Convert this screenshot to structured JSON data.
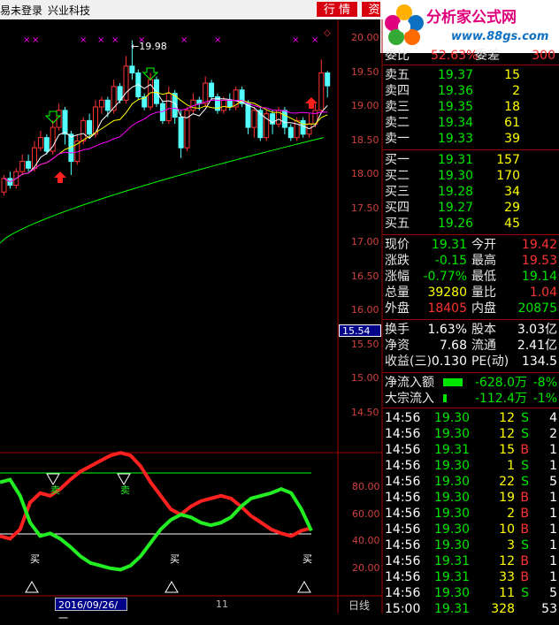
{
  "titlebar": {
    "login_status": "易未登录",
    "stock_name": "兴业科技",
    "btn_quote": "行 情",
    "btn_info": "资"
  },
  "logo": {
    "name": "分析家公式网",
    "url": "www.88gs.com"
  },
  "chart": {
    "price_axis": [
      "20.00",
      "19.50",
      "19.00",
      "18.50",
      "18.00",
      "17.50",
      "17.00",
      "16.50",
      "16.00",
      "15.50",
      "15.00",
      "14.50"
    ],
    "high_label": "19.98",
    "current_price_tag": "15.54",
    "sub_axis": [
      "80.00",
      "60.00",
      "40.00",
      "20.00"
    ],
    "sub_labels": {
      "sell": "卖",
      "buy": "买"
    },
    "date_tag": "2016/09/26/一",
    "month_tick": "11",
    "period": "日线",
    "colors": {
      "up": "#ff3232",
      "down": "#54ffff",
      "ma5": "#ffffff",
      "ma10": "#ffff00",
      "ma20": "#ff00ff",
      "ma60": "#00ff00"
    }
  },
  "quote": {
    "weibi": {
      "label": "委比",
      "value": "52.63%",
      "label2": "委差",
      "value2": "300"
    },
    "asks": [
      {
        "label": "卖五",
        "price": "19.37",
        "vol": "15"
      },
      {
        "label": "卖四",
        "price": "19.36",
        "vol": "2"
      },
      {
        "label": "卖三",
        "price": "19.35",
        "vol": "18"
      },
      {
        "label": "卖二",
        "price": "19.34",
        "vol": "61"
      },
      {
        "label": "卖一",
        "price": "19.33",
        "vol": "39"
      }
    ],
    "bids": [
      {
        "label": "买一",
        "price": "19.31",
        "vol": "157"
      },
      {
        "label": "买二",
        "price": "19.30",
        "vol": "170"
      },
      {
        "label": "买三",
        "price": "19.28",
        "vol": "34"
      },
      {
        "label": "买四",
        "price": "19.27",
        "vol": "29"
      },
      {
        "label": "买五",
        "price": "19.26",
        "vol": "45"
      }
    ],
    "stats": [
      {
        "l1": "现价",
        "v1": "19.31",
        "c1": "dn",
        "l2": "今开",
        "v2": "19.42",
        "c2": "up"
      },
      {
        "l1": "涨跌",
        "v1": "-0.15",
        "c1": "dn",
        "l2": "最高",
        "v2": "19.53",
        "c2": "up"
      },
      {
        "l1": "涨幅",
        "v1": "-0.77%",
        "c1": "dn",
        "l2": "最低",
        "v2": "19.14",
        "c2": "dn"
      },
      {
        "l1": "总量",
        "v1": "39280",
        "c1": "yel",
        "l2": "量比",
        "v2": "1.04",
        "c2": "up"
      },
      {
        "l1": "外盘",
        "v1": "18405",
        "c1": "up",
        "l2": "内盘",
        "v2": "20875",
        "c2": "dn"
      }
    ],
    "fund": [
      {
        "l1": "换手",
        "v1": "1.63%",
        "l2": "股本",
        "v2": "3.03亿"
      },
      {
        "l1": "净资",
        "v1": "7.68",
        "l2": "流通",
        "v2": "2.41亿"
      },
      {
        "l1": "收益(三)",
        "v1": "0.130",
        "l2": "PE(动)",
        "v2": "134.5"
      }
    ],
    "flow": [
      {
        "label": "净流入额",
        "value": "-628.0万",
        "pct": "-8%"
      },
      {
        "label": "大宗流入",
        "value": "-112.4万",
        "pct": "-1%"
      }
    ]
  },
  "ticks": [
    {
      "time": "14:56",
      "price": "19.30",
      "vol": "12",
      "bs": "S",
      "n": "4"
    },
    {
      "time": "14:56",
      "price": "19.30",
      "vol": "12",
      "bs": "S",
      "n": "2"
    },
    {
      "time": "14:56",
      "price": "19.31",
      "vol": "15",
      "bs": "B",
      "n": "1"
    },
    {
      "time": "14:56",
      "price": "19.30",
      "vol": "1",
      "bs": "S",
      "n": "1"
    },
    {
      "time": "14:56",
      "price": "19.30",
      "vol": "22",
      "bs": "S",
      "n": "5"
    },
    {
      "time": "14:56",
      "price": "19.30",
      "vol": "19",
      "bs": "B",
      "n": "1"
    },
    {
      "time": "14:56",
      "price": "19.30",
      "vol": "2",
      "bs": "B",
      "n": "1"
    },
    {
      "time": "14:56",
      "price": "19.30",
      "vol": "10",
      "bs": "B",
      "n": "1"
    },
    {
      "time": "14:56",
      "price": "19.30",
      "vol": "3",
      "bs": "S",
      "n": "1"
    },
    {
      "time": "14:56",
      "price": "19.31",
      "vol": "12",
      "bs": "B",
      "n": "1"
    },
    {
      "time": "14:56",
      "price": "19.31",
      "vol": "33",
      "bs": "B",
      "n": "1"
    },
    {
      "time": "14:56",
      "price": "19.30",
      "vol": "11",
      "bs": "S",
      "n": "5"
    },
    {
      "time": "15:00",
      "price": "19.31",
      "vol": "328",
      "bs": "",
      "n": "53"
    }
  ]
}
